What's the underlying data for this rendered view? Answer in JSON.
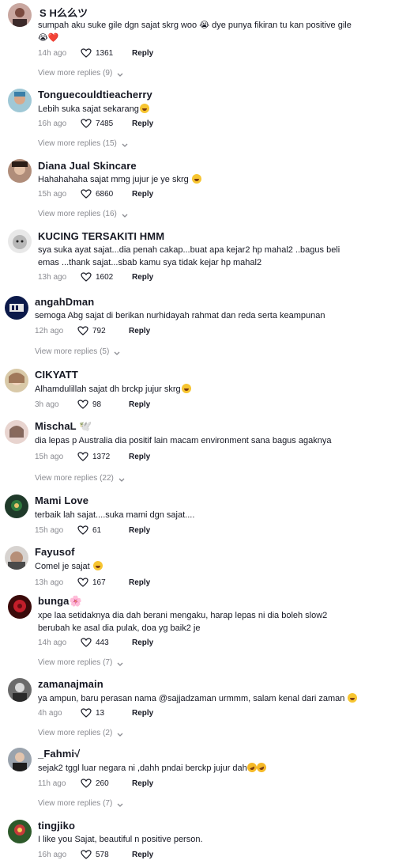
{
  "colors": {
    "muted": "#8a8b91",
    "text": "#161823",
    "heart_outline": "#161823",
    "emoji_heart": "#e0193a"
  },
  "comments": [
    {
      "username": "S H么么ツ",
      "text": "sumpah aku suke gile dgn sajat skrg woo 😭 dye punya fikiran tu kan positive gile",
      "text2": "",
      "emoji_line": "😭❤️",
      "time": "14h ago",
      "likes": "1361",
      "reply_label": "Reply",
      "more_replies": "View more replies (9)"
    },
    {
      "username": "Tonguecouldtieacherry",
      "text": "Lebih suka sajat sekarang",
      "time": "16h ago",
      "likes": "7485",
      "reply_label": "Reply",
      "more_replies": "View more replies (15)"
    },
    {
      "username": "Diana Jual Skincare",
      "text": "Hahahahaha sajat mmg jujur je ye skrg",
      "time": "15h ago",
      "likes": "6860",
      "reply_label": "Reply",
      "more_replies": "View more replies (16)"
    },
    {
      "username": "KUCING TERSAKITI HMM",
      "text": "sya suka ayat sajat...dia penah cakap...buat apa kejar2 hp mahal2 ..bagus beli",
      "text2": "emas ...thank sajat...sbab kamu sya tidak kejar hp mahal2",
      "time": "13h ago",
      "likes": "1602",
      "reply_label": "Reply"
    },
    {
      "username": "angahDman",
      "text": "semoga Abg sajat di berikan nurhidayah rahmat dan reda serta keampunan",
      "time": "12h ago",
      "likes": "792",
      "reply_label": "Reply",
      "more_replies": "View more replies (5)"
    },
    {
      "username": "CIKYATT",
      "text": "Alhamdulillah sajat dh brckp jujur skrg",
      "time": "3h ago",
      "likes": "98",
      "reply_label": "Reply"
    },
    {
      "username": "MischaL 🕊️",
      "text": "dia lepas p Australia dia positif lain macam environment sana bagus agaknya",
      "time": "15h ago",
      "likes": "1372",
      "reply_label": "Reply",
      "more_replies": "View more replies (22)"
    },
    {
      "username": "Mami Love",
      "text": "terbaik lah sajat....suka mami dgn sajat....",
      "time": "15h ago",
      "likes": "61",
      "reply_label": "Reply"
    },
    {
      "username": "Fayusof",
      "text": "Comel je sajat",
      "time": "13h ago",
      "likes": "167",
      "reply_label": "Reply"
    },
    {
      "username": "bunga🌸",
      "text": "xpe laa setidaknya dia dah berani mengaku, harap lepas ni dia boleh slow2",
      "text2": "berubah ke asal dia pulak, doa yg baik2 je",
      "time": "14h ago",
      "likes": "443",
      "reply_label": "Reply",
      "more_replies": "View more replies (7)"
    },
    {
      "username": "zamanajmain",
      "text": "ya ampun, baru perasan nama @sajjadzaman urmmm, salam kenal dari zaman",
      "time": "4h ago",
      "likes": "13",
      "reply_label": "Reply",
      "more_replies": "View more replies (2)"
    },
    {
      "username": "_Fahmi√",
      "text": "sejak2 tggl luar negara ni ,dahh pndai berckp jujur dah",
      "time": "11h ago",
      "likes": "260",
      "reply_label": "Reply",
      "more_replies": "View more replies (7)"
    },
    {
      "username": "tingjiko",
      "text": "I like you Sajat, beautiful n positive person.",
      "time": "16h ago",
      "likes": "578",
      "reply_label": "Reply"
    }
  ],
  "icons": {
    "like": "heart-outline-icon",
    "expand": "chevron-down-icon"
  }
}
